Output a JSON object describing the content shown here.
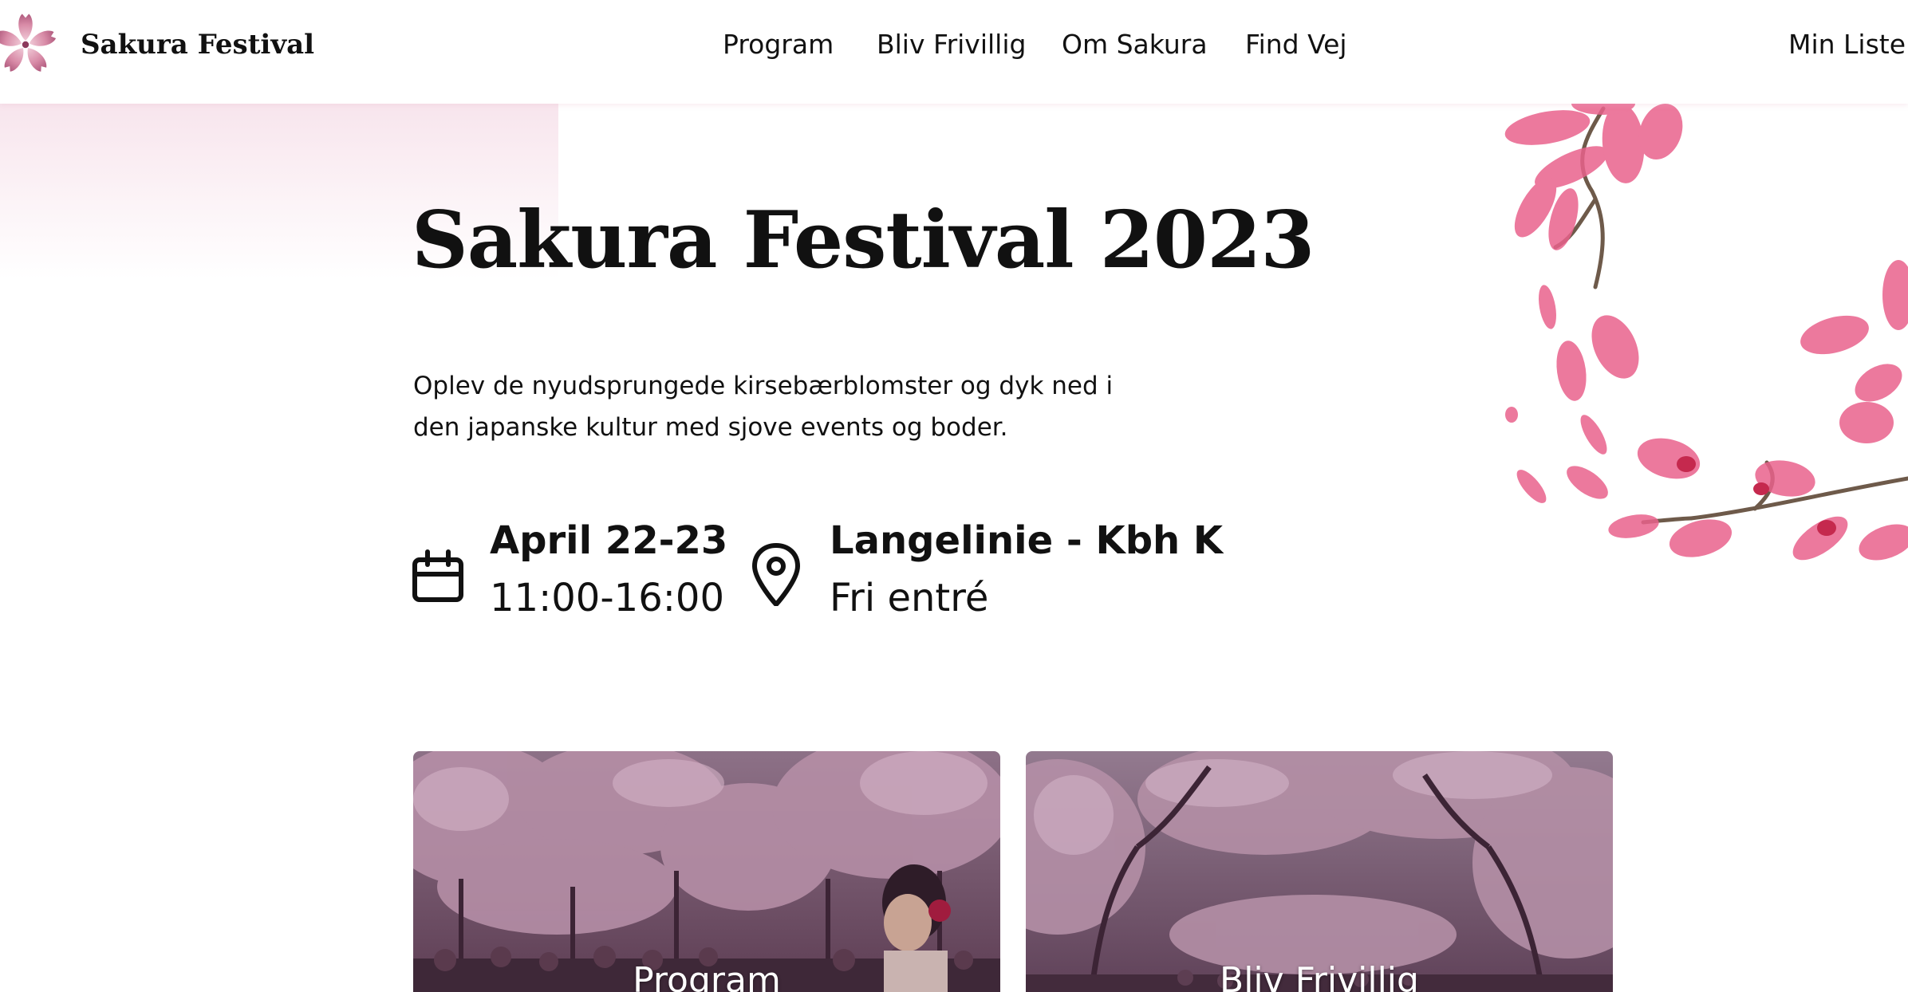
{
  "brand": {
    "name": "Sakura Festival",
    "logo_icon": "sakura-flower-icon"
  },
  "nav": {
    "items": [
      "Program",
      "Bliv Frivillig",
      "Om Sakura",
      "Find Vej"
    ],
    "my_list": "Min Liste"
  },
  "hero": {
    "title": "Sakura Festival 2023",
    "description": "Oplev de nyudsprungede kirsebærblomster og dyk ned i den japanske kultur med sjove events og boder."
  },
  "info": {
    "date": {
      "icon": "calendar-icon",
      "title": "April 22-23",
      "subtitle": "11:00-16:00"
    },
    "location": {
      "icon": "map-pin-icon",
      "title": "Langelinie - Kbh K",
      "subtitle": "Fri entré"
    }
  },
  "cards": [
    {
      "label": "Program",
      "image": "cherry-trees-crowd-photo"
    },
    {
      "label": "Bliv Frivillig",
      "image": "cherry-trees-path-photo"
    }
  ],
  "colors": {
    "text": "#111111",
    "blossom_pink": "#e9618c",
    "card_overlay": "#7a5570"
  }
}
